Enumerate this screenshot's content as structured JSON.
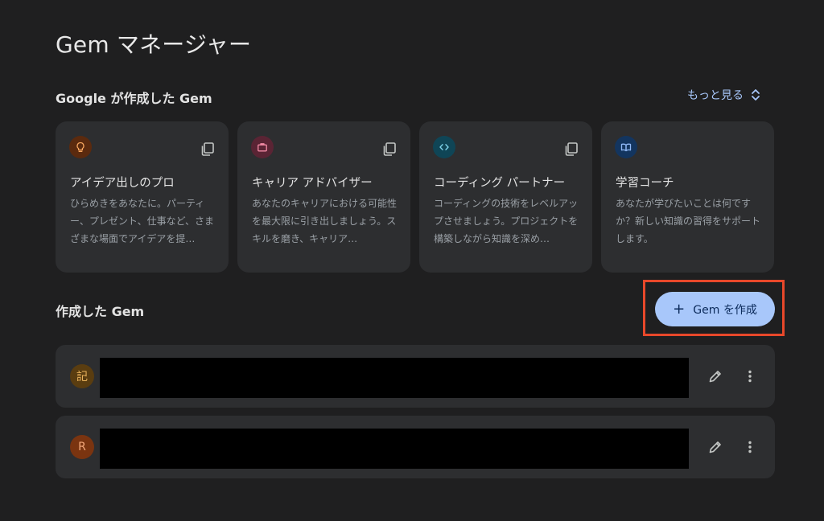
{
  "page": {
    "title": "Gem マネージャー"
  },
  "google_section": {
    "title": "Google が作成した Gem",
    "more_label": "もっと見る",
    "cards": [
      {
        "title": "アイデア出しのプロ",
        "description": "ひらめきをあなたに。パーティー、プレゼント、仕事など、さまざまな場面でアイデアを提…",
        "icon": "lightbulb-icon",
        "icon_bg": "#5b2a0e",
        "icon_color": "#f6a55e"
      },
      {
        "title": "キャリア アドバイザー",
        "description": "あなたのキャリアにおける可能性を最大限に引き出しましょう。スキルを磨き、キャリア…",
        "icon": "briefcase-icon",
        "icon_bg": "#5a2434",
        "icon_color": "#f28aa5"
      },
      {
        "title": "コーディング パートナー",
        "description": "コーディングの技術をレベルアップさせましょう。プロジェクトを構築しながら知識を深め…",
        "icon": "code-icon",
        "icon_bg": "#0f4556",
        "icon_color": "#7fd3ea"
      },
      {
        "title": "学習コーチ",
        "description": "あなたが学びたいことは何ですか？新しい知識の習得をサポートします。",
        "icon": "open-book-icon",
        "icon_bg": "#13355f",
        "icon_color": "#8fb8f5"
      }
    ]
  },
  "my_section": {
    "title": "作成した Gem",
    "create_label": "Gem を作成",
    "gems": [
      {
        "avatar": "記"
      },
      {
        "avatar": "R"
      }
    ]
  },
  "colors": {
    "background": "#1f1f20",
    "card": "#2d2e30",
    "accent": "#a8c7fa",
    "highlight": "#e8482a"
  }
}
